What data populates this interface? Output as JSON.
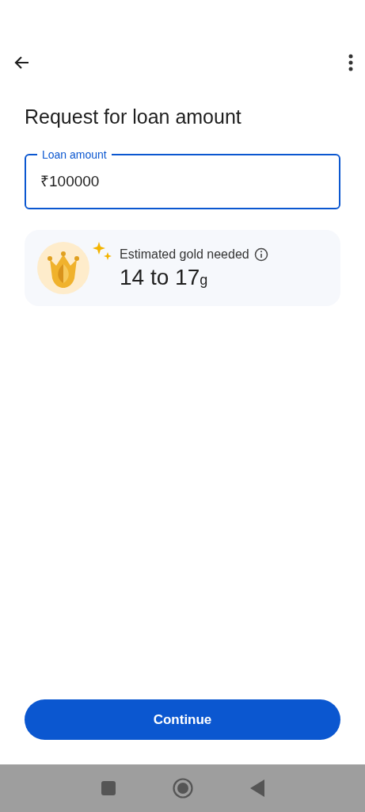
{
  "title": "Request for loan amount",
  "loan_field": {
    "label": "Loan amount",
    "prefix": "₹",
    "value": "100000"
  },
  "estimate": {
    "label": "Estimated gold needed",
    "value": "14 to 17",
    "unit": "g"
  },
  "continue_button": {
    "label": "Continue"
  }
}
